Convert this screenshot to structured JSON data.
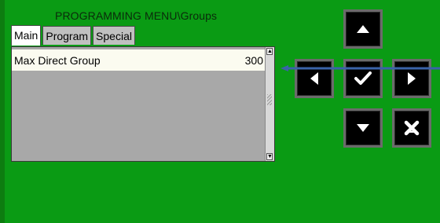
{
  "window": {
    "title": "PROGRAMMING MENU\\Groups"
  },
  "tabs": [
    {
      "label": "Main",
      "active": true
    },
    {
      "label": "Program",
      "active": false
    },
    {
      "label": "Special",
      "active": false
    }
  ],
  "list": {
    "items": [
      {
        "label": "Max Direct Group",
        "value": "300",
        "selected": true
      }
    ]
  },
  "nav": {
    "up": "arrow-up-icon",
    "left": "arrow-left-icon",
    "ok": "checkmark-icon",
    "right": "arrow-right-icon",
    "down": "arrow-down-icon",
    "cancel": "cancel-x-icon"
  },
  "colors": {
    "background": "#0a9b14",
    "button": "#000000",
    "selection": "#fbfbf0",
    "pointer_arrow": "#3a63a8"
  }
}
